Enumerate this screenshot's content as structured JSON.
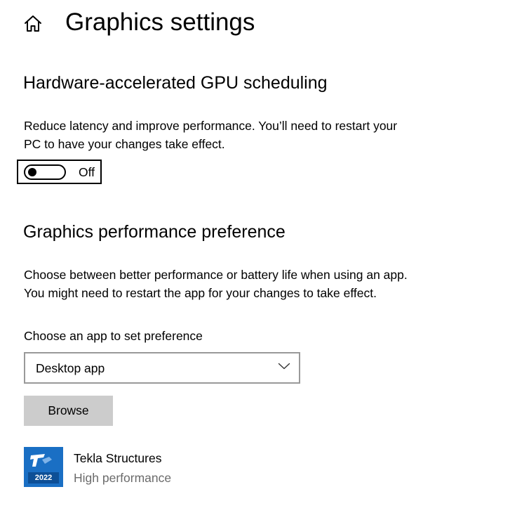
{
  "page": {
    "title": "Graphics settings",
    "home_icon": "home-icon"
  },
  "gpu_scheduling": {
    "heading": "Hardware-accelerated GPU scheduling",
    "description_line1": "Reduce latency and improve performance. You’ll need to restart your",
    "description_line2": "PC to have your changes take effect.",
    "toggle_state": "Off",
    "toggle_on": false
  },
  "performance_preference": {
    "heading": "Graphics performance preference",
    "description_line1": "Choose between better performance or battery life when using an app.",
    "description_line2": "You might need to restart the app for your changes to take effect.",
    "choose_label": "Choose an app to set preference",
    "selected_app_type": "Desktop app",
    "dropdown_icon": "chevron-down-icon",
    "browse_label": "Browse",
    "apps": [
      {
        "name": "Tekla Structures",
        "preference": "High performance",
        "icon_label": "2022",
        "icon": "tekla-structures-app-icon"
      }
    ]
  },
  "colors": {
    "background": "#ffffff",
    "text": "#000000",
    "secondary_text": "#6b6b6b",
    "button_bg": "#cccccc",
    "dropdown_border": "#999999",
    "app_icon_blue": "#1a6fc4"
  }
}
